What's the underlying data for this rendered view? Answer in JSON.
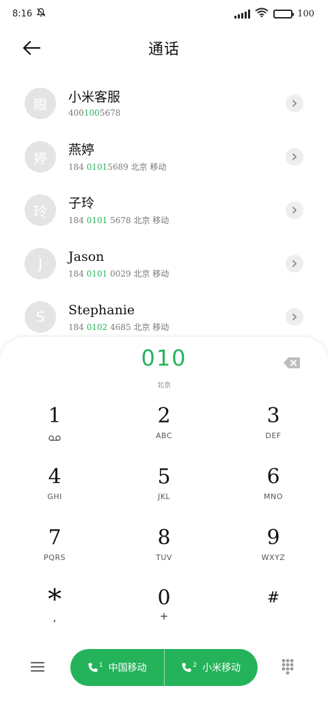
{
  "status_bar": {
    "time": "8:16",
    "battery": "100",
    "icons": [
      "bell-muted-icon",
      "signal-icon",
      "wifi-icon",
      "battery-icon"
    ]
  },
  "header": {
    "title": "通话",
    "back_icon": "back-arrow-icon"
  },
  "contacts": [
    {
      "avatar": "眼",
      "name": "小米客服",
      "number_pre": "400",
      "number_hl": "100",
      "number_post": "5678",
      "location": ""
    },
    {
      "avatar": "婷",
      "name": "燕婷",
      "number_pre": "184 ",
      "number_hl": "0101",
      "number_post": "5689",
      "location": " 北京 移动"
    },
    {
      "avatar": "玲",
      "name": "子玲",
      "number_pre": "184 ",
      "number_hl": "0101",
      "number_post": " 5678",
      "location": " 北京 移动"
    },
    {
      "avatar": "J",
      "name": "Jason",
      "number_pre": "184 ",
      "number_hl": "0101",
      "number_post": " 0029",
      "location": " 北京 移动"
    },
    {
      "avatar": "S",
      "name": "Stephanie",
      "number_pre": "184 ",
      "number_hl": "0102",
      "number_post": " 4685",
      "location": " 北京 移动"
    }
  ],
  "dialer": {
    "number": "010",
    "location": "北京"
  },
  "keys": [
    {
      "digit": "1",
      "letters": "",
      "sub": "voicemail"
    },
    {
      "digit": "2",
      "letters": "ABC"
    },
    {
      "digit": "3",
      "letters": "DEF"
    },
    {
      "digit": "4",
      "letters": "GHI"
    },
    {
      "digit": "5",
      "letters": "JKL"
    },
    {
      "digit": "6",
      "letters": "MNO"
    },
    {
      "digit": "7",
      "letters": "PQRS"
    },
    {
      "digit": "8",
      "letters": "TUV"
    },
    {
      "digit": "9",
      "letters": "WXYZ"
    },
    {
      "digit": "*",
      "letters": "",
      "sub_text": ","
    },
    {
      "digit": "0",
      "letters": "",
      "sub_text": "+"
    },
    {
      "digit": "#",
      "letters": ""
    }
  ],
  "bottom_bar": {
    "sim1_label": "中国移动",
    "sim1_index": "1",
    "sim2_label": "小米移动",
    "sim2_index": "2"
  },
  "colors": {
    "accent": "#24b35a",
    "avatar_bg": "#e4e4e4"
  }
}
